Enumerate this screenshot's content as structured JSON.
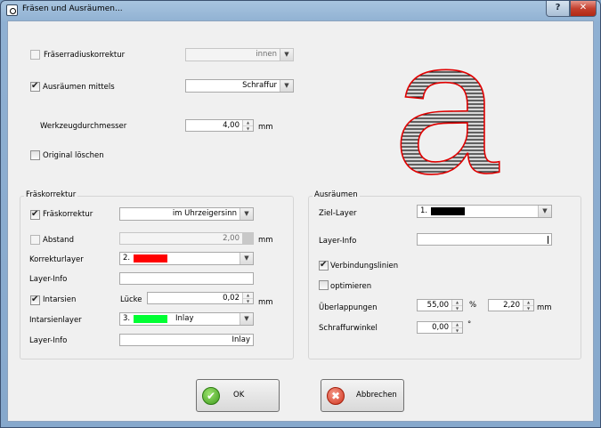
{
  "window": {
    "title": "Fräsen und Ausräumen...",
    "help_label": "?",
    "close_label": "✕"
  },
  "top": {
    "fraeserradius": {
      "label": "Fräserradiuskorrektur",
      "checked": false,
      "enabled": false,
      "value": "innen"
    },
    "ausraeumen": {
      "label": "Ausräumen mittels",
      "checked": true,
      "value": "Schraffur"
    },
    "werkzeug": {
      "label": "Werkzeugdurchmesser",
      "value": "4,00",
      "unit": "mm"
    },
    "original": {
      "label": "Original löschen",
      "checked": false
    }
  },
  "preview": {
    "glyph": "a"
  },
  "fraeskorrektur": {
    "title": "Fräskorrektur",
    "fraeskorrektur": {
      "label": "Fräskorrektur",
      "checked": true,
      "value": "im Uhrzeigersinn"
    },
    "abstand": {
      "label": "Abstand",
      "checked": false,
      "value": "2,00",
      "unit": "mm"
    },
    "korrekturlayer": {
      "label": "Korrekturlayer",
      "number": "2.",
      "color": "#ff0000"
    },
    "layerinfo1": {
      "label": "Layer-Info",
      "value": ""
    },
    "intarsien": {
      "label": "Intarsien",
      "checked": true,
      "luecke_label": "Lücke",
      "luecke_value": "0,02",
      "unit": "mm"
    },
    "intarsienlayer": {
      "label": "Intarsienlayer",
      "number": "3.",
      "color": "#00ff33",
      "value": "Inlay"
    },
    "layerinfo2": {
      "label": "Layer-Info",
      "value": "Inlay"
    }
  },
  "ausraeumen_group": {
    "title": "Ausräumen",
    "ziellayer": {
      "label": "Ziel-Layer",
      "number": "1.",
      "color": "#000000"
    },
    "layerinfo": {
      "label": "Layer-Info",
      "value": ""
    },
    "verbindungslinien": {
      "label": "Verbindungslinien",
      "checked": true
    },
    "optimieren": {
      "label": "optimieren",
      "checked": false
    },
    "ueberlappungen": {
      "label": "Überlappungen",
      "value1": "55,00",
      "unit1": "%",
      "value2": "2,20",
      "unit2": "mm"
    },
    "schraffurwinkel": {
      "label": "Schraffurwinkel",
      "value": "0,00",
      "unit": "°"
    }
  },
  "buttons": {
    "ok": "OK",
    "cancel": "Abbrechen"
  }
}
